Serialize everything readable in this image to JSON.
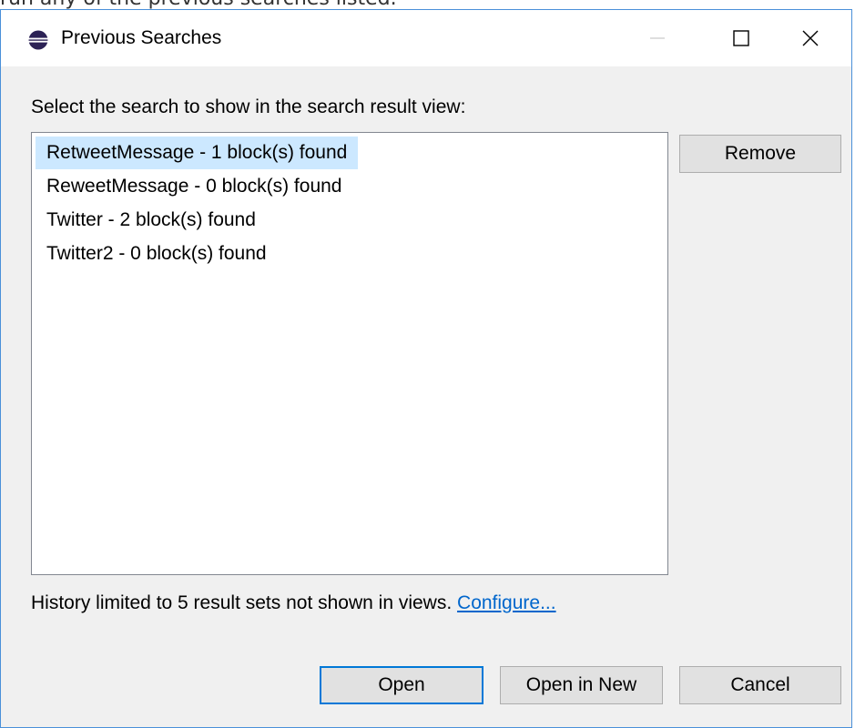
{
  "background": {
    "caption": "run any of the previous searches listed."
  },
  "dialog": {
    "title": "Previous Searches",
    "icon": "eclipse-icon",
    "prompt": "Select the search to show in the search result view:",
    "items": [
      {
        "label": "RetweetMessage - 1 block(s) found",
        "selected": true
      },
      {
        "label": "ReweetMessage - 0 block(s) found",
        "selected": false
      },
      {
        "label": "Twitter - 2 block(s) found",
        "selected": false
      },
      {
        "label": "Twitter2 - 0 block(s) found",
        "selected": false
      }
    ],
    "remove_label": "Remove",
    "footer_text": "History limited to 5 result sets not shown in views.",
    "configure_link": "Configure...",
    "buttons": {
      "open": "Open",
      "open_in_new": "Open in New",
      "cancel": "Cancel"
    }
  },
  "colors": {
    "selection": "#cce8ff",
    "accent": "#0078d7",
    "link": "#0066cc"
  }
}
